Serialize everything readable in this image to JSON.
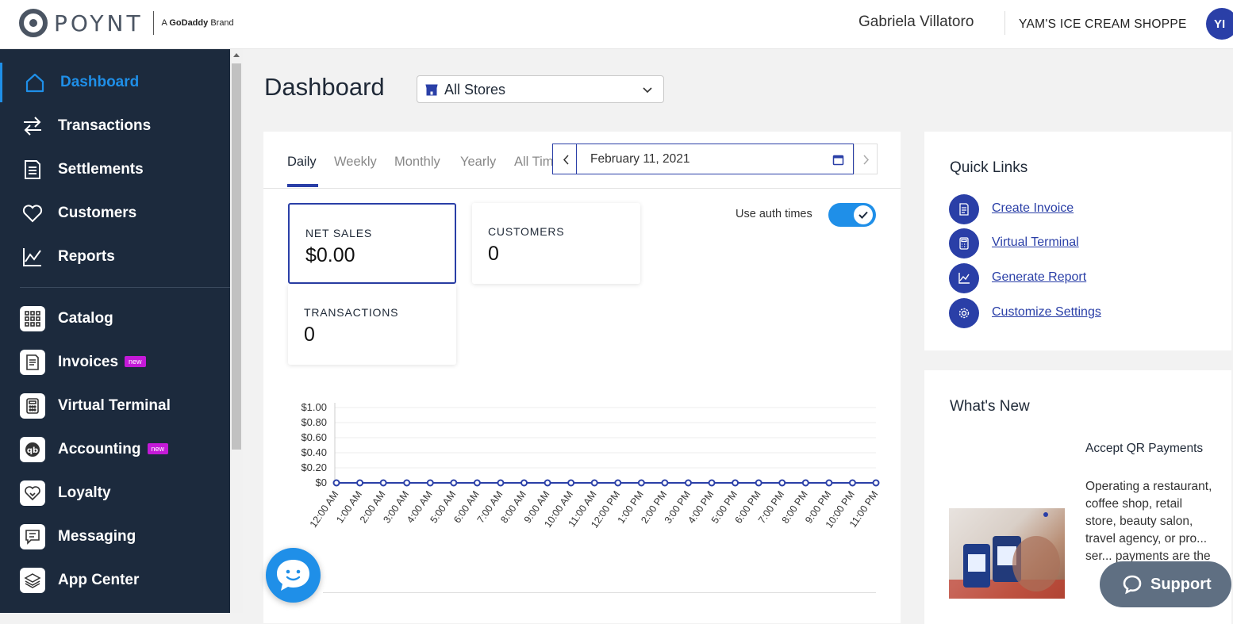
{
  "header": {
    "logo_text": "POYNT",
    "brand_prefix": "A",
    "brand_name": "GoDaddy",
    "brand_suffix": "Brand",
    "user_name": "Gabriela Villatoro",
    "merchant_name": "YAM'S ICE CREAM SHOPPE",
    "avatar_initials": "YI"
  },
  "sidebar": {
    "items": [
      {
        "label": "Dashboard",
        "icon": "home-icon",
        "active": true
      },
      {
        "label": "Transactions",
        "icon": "arrows-icon"
      },
      {
        "label": "Settlements",
        "icon": "receipt-icon"
      },
      {
        "label": "Customers",
        "icon": "heart-icon"
      },
      {
        "label": "Reports",
        "icon": "chart-icon"
      },
      {
        "label": "Catalog",
        "icon": "grid-icon"
      },
      {
        "label": "Invoices",
        "icon": "invoice-icon",
        "badge": "new"
      },
      {
        "label": "Virtual Terminal",
        "icon": "calculator-icon"
      },
      {
        "label": "Accounting",
        "icon": "quickbooks-icon",
        "badge": "new"
      },
      {
        "label": "Loyalty",
        "icon": "loyalty-heart-icon"
      },
      {
        "label": "Messaging",
        "icon": "message-icon"
      },
      {
        "label": "App Center",
        "icon": "layers-icon"
      }
    ]
  },
  "page": {
    "title": "Dashboard",
    "store_select": "All Stores"
  },
  "tabs": [
    "Daily",
    "Weekly",
    "Monthly",
    "Yearly",
    "All Time"
  ],
  "date": "February 11, 2021",
  "metrics": [
    {
      "label": "NET SALES",
      "value": "$0.00"
    },
    {
      "label": "CUSTOMERS",
      "value": "0"
    },
    {
      "label": "TRANSACTIONS",
      "value": "0"
    }
  ],
  "toggle": {
    "label": "Use auth times",
    "on": true
  },
  "colors": {
    "accent": "#2a3fa7",
    "sidebar": "#1c2a3d",
    "active": "#1f8fe8",
    "badge": "#c41ad8"
  },
  "chart_data": {
    "type": "line",
    "x": [
      "12:00 AM",
      "1:00 AM",
      "2:00 AM",
      "3:00 AM",
      "4:00 AM",
      "5:00 AM",
      "6:00 AM",
      "7:00 AM",
      "8:00 AM",
      "9:00 AM",
      "10:00 AM",
      "11:00 AM",
      "12:00 PM",
      "1:00 PM",
      "2:00 PM",
      "3:00 PM",
      "4:00 PM",
      "5:00 PM",
      "6:00 PM",
      "7:00 PM",
      "8:00 PM",
      "9:00 PM",
      "10:00 PM",
      "11:00 PM"
    ],
    "series": [
      {
        "values": [
          0,
          0,
          0,
          0,
          0,
          0,
          0,
          0,
          0,
          0,
          0,
          0,
          0,
          0,
          0,
          0,
          0,
          0,
          0,
          0,
          0,
          0,
          0,
          0
        ]
      }
    ],
    "yticks": [
      "$0",
      "$0.20",
      "$0.40",
      "$0.60",
      "$0.80",
      "$1.00"
    ],
    "ylim": [
      0,
      1
    ],
    "grid": true
  },
  "quick_links": {
    "title": "Quick Links",
    "items": [
      {
        "label": "Create Invoice",
        "icon": "invoice-icon"
      },
      {
        "label": "Virtual Terminal",
        "icon": "calculator-icon"
      },
      {
        "label": "Generate Report",
        "icon": "chart-icon"
      },
      {
        "label": "Customize Settings",
        "icon": "gear-icon"
      }
    ]
  },
  "whats_new": {
    "title": "What's New",
    "item_title": "Accept QR Payments",
    "item_body": "Operating a restaurant, coffee shop, retail store, beauty salon, travel agency, or pro... ser... payments are the"
  },
  "support": {
    "label": "Support"
  }
}
